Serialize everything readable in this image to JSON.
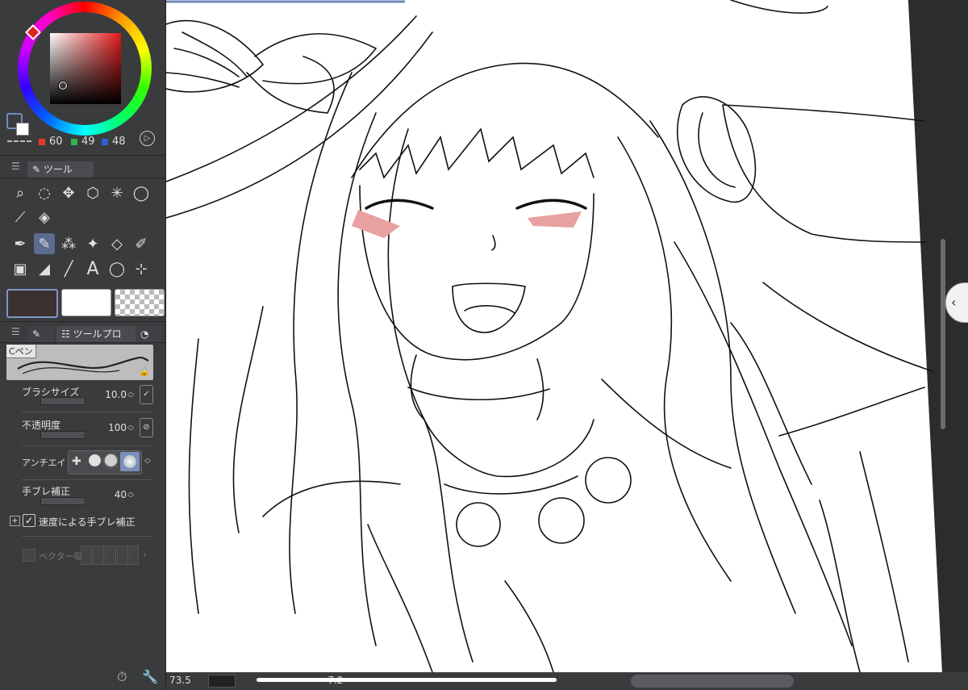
{
  "color_panel": {
    "rgb": {
      "r": "60",
      "g": "49",
      "b": "48"
    },
    "colors": {
      "r": "#e53a2a",
      "g": "#35b04a",
      "b": "#2f5fd7",
      "main": "#3c3130",
      "sub": "#ffffff"
    }
  },
  "tool_panel": {
    "tab_label": "ツール",
    "icons": [
      "zoom-icon",
      "rotate-icon",
      "move-icon",
      "object-icon",
      "auto-select-icon",
      "lasso-icon",
      "eyedropper-icon",
      "fill-icon",
      "pen-icon",
      "pencil-icon",
      "airbrush-icon",
      "decoration-icon",
      "eraser-icon",
      "blend-icon",
      "gradient-icon",
      "figure-icon",
      "line-icon",
      "text-icon",
      "balloon-icon",
      "ruler-icon"
    ]
  },
  "tool_props": {
    "tab_label": "ツールプロ",
    "brush_name": "Cペン",
    "brush_size_label": "ブラシサイズ",
    "brush_size_value": "10.0",
    "opacity_label": "不透明度",
    "opacity_value": "100",
    "antialias_label": "アンチエイリ",
    "stabilizer_label": "手ブレ補正",
    "stabilizer_value": "40",
    "speed_stabilizer_label": "速度による手ブレ補正",
    "speed_stabilizer_checked": true,
    "vector_label": "ベクター吸"
  },
  "status": {
    "zoom": "73.5",
    "rotation": "-7.2"
  }
}
